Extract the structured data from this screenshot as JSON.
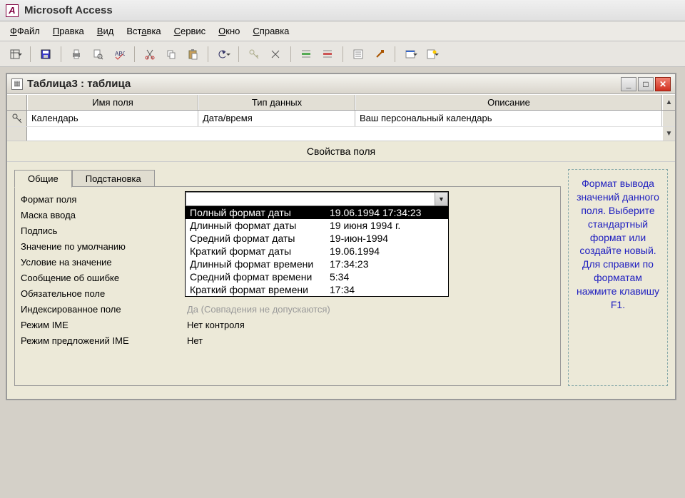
{
  "app": {
    "title": "Microsoft Access"
  },
  "menubar": {
    "file": "Файл",
    "edit": "Правка",
    "view": "Вид",
    "insert": "Вставка",
    "tools": "Сервис",
    "window": "Окно",
    "help": "Справка"
  },
  "window": {
    "title": "Таблица3 : таблица"
  },
  "grid": {
    "headers": {
      "name": "Имя поля",
      "type": "Тип данных",
      "desc": "Описание"
    },
    "row": {
      "name": "Календарь",
      "type": "Дата/время",
      "desc": "Ваш персональный календарь"
    }
  },
  "props": {
    "title": "Свойства поля",
    "tabs": {
      "general": "Общие",
      "lookup": "Подстановка"
    },
    "labels": {
      "format": "Формат поля",
      "mask": "Маска ввода",
      "caption": "Подпись",
      "default": "Значение по умолчанию",
      "valrule": "Условие на значение",
      "valtext": "Сообщение об ошибке",
      "required": "Обязательное поле",
      "indexed": "Индексированное поле",
      "ime": "Режим IME",
      "imeSentence": "Режим предложений IME"
    },
    "values": {
      "indexed_obscured": "Да (Совпадения не допускаются)",
      "ime": "Нет контроля",
      "imeSentence": "Нет"
    },
    "dropdown": {
      "items": [
        {
          "name": "Полный формат даты",
          "example": "19.06.1994 17:34:23"
        },
        {
          "name": "Длинный формат даты",
          "example": "19 июня 1994 г."
        },
        {
          "name": "Средний формат даты",
          "example": "19-июн-1994"
        },
        {
          "name": "Краткий формат даты",
          "example": "19.06.1994"
        },
        {
          "name": "Длинный формат времени",
          "example": "17:34:23"
        },
        {
          "name": "Средний формат времени",
          "example": "5:34"
        },
        {
          "name": "Краткий формат времени",
          "example": "17:34"
        }
      ]
    }
  },
  "help": {
    "text": "Формат вывода значений данного поля. Выберите стандартный формат или создайте новый. Для справки по форматам нажмите клавишу F1."
  }
}
